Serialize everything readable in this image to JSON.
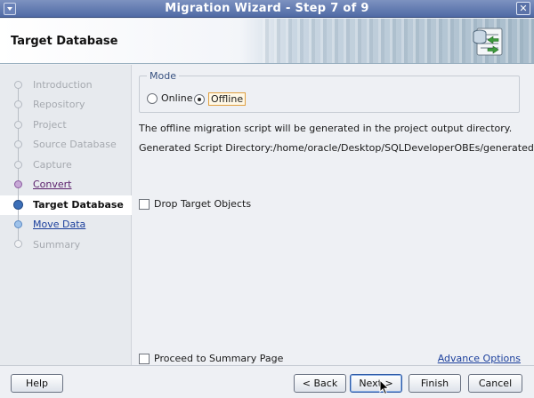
{
  "window": {
    "title": "Migration Wizard - Step 7 of 9"
  },
  "header": {
    "title": "Target Database",
    "icon": "database-migration-icon"
  },
  "steps": [
    {
      "label": "Introduction",
      "state": "done"
    },
    {
      "label": "Repository",
      "state": "done"
    },
    {
      "label": "Project",
      "state": "done"
    },
    {
      "label": "Source Database",
      "state": "done"
    },
    {
      "label": "Capture",
      "state": "done"
    },
    {
      "label": "Convert",
      "state": "visited"
    },
    {
      "label": "Target Database",
      "state": "current"
    },
    {
      "label": "Move Data",
      "state": "next"
    },
    {
      "label": "Summary",
      "state": "end"
    }
  ],
  "mode": {
    "legend": "Mode",
    "options": [
      "Online",
      "Offline"
    ],
    "selected": "Offline"
  },
  "info": {
    "line1": "The offline migration script will be generated in the project output directory.",
    "line2": "Generated Script Directory:/home/oracle/Desktop/SQLDeveloperOBEs/generated"
  },
  "options": {
    "drop_target": {
      "label": "Drop Target Objects",
      "checked": false
    },
    "proceed_summary": {
      "label": "Proceed to Summary Page",
      "checked": false
    }
  },
  "advance_link": "Advance Options",
  "buttons": {
    "help": "Help",
    "back": "< Back",
    "next": "Next >",
    "finish": "Finish",
    "cancel": "Cancel"
  }
}
